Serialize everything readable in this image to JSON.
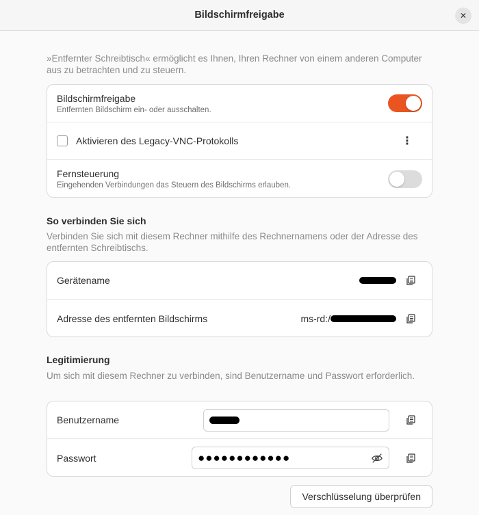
{
  "window": {
    "title": "Bildschirmfreigabe",
    "close_glyph": "✕"
  },
  "intro_text": "»Entfernter Schreibtisch« ermöglicht es Ihnen, Ihren Rechner von einem anderen Computer aus zu betrachten und zu steuern.",
  "sharing": {
    "screen_sharing": {
      "title": "Bildschirmfreigabe",
      "subtitle": "Entfernten Bildschirm ein- oder ausschalten.",
      "enabled": true
    },
    "legacy_vnc": {
      "label": "Aktivieren des Legacy-VNC-Protokolls",
      "checked": false,
      "menu_glyph": "⋮"
    },
    "remote_control": {
      "title": "Fernsteuerung",
      "subtitle": "Eingehenden Verbindungen das Steuern des Bildschirms erlauben.",
      "enabled": false
    }
  },
  "connect": {
    "heading": "So verbinden Sie sich",
    "description": "Verbinden Sie sich mit diesem Rechner mithilfe des Rechnernamens oder der Adresse des entfernten Schreibtischs.",
    "device_name_label": "Gerätename",
    "address_label": "Adresse des entfernten Bildschirms",
    "address_prefix": "ms-rd:/"
  },
  "auth": {
    "heading": "Legitimierung",
    "description": "Um sich mit diesem Rechner zu verbinden, sind Benutzername und Passwort erforderlich.",
    "username_label": "Benutzername",
    "password_label": "Passwort",
    "password_masked": "●●●●●●●●●●●●"
  },
  "verify_button": "Verschlüsselung überprüfen",
  "colors": {
    "accent": "#e95420",
    "switch_off": "#dcdcdc"
  },
  "icons": [
    "close-icon",
    "kebab-menu-icon",
    "copy-icon",
    "eye-slash-icon"
  ]
}
